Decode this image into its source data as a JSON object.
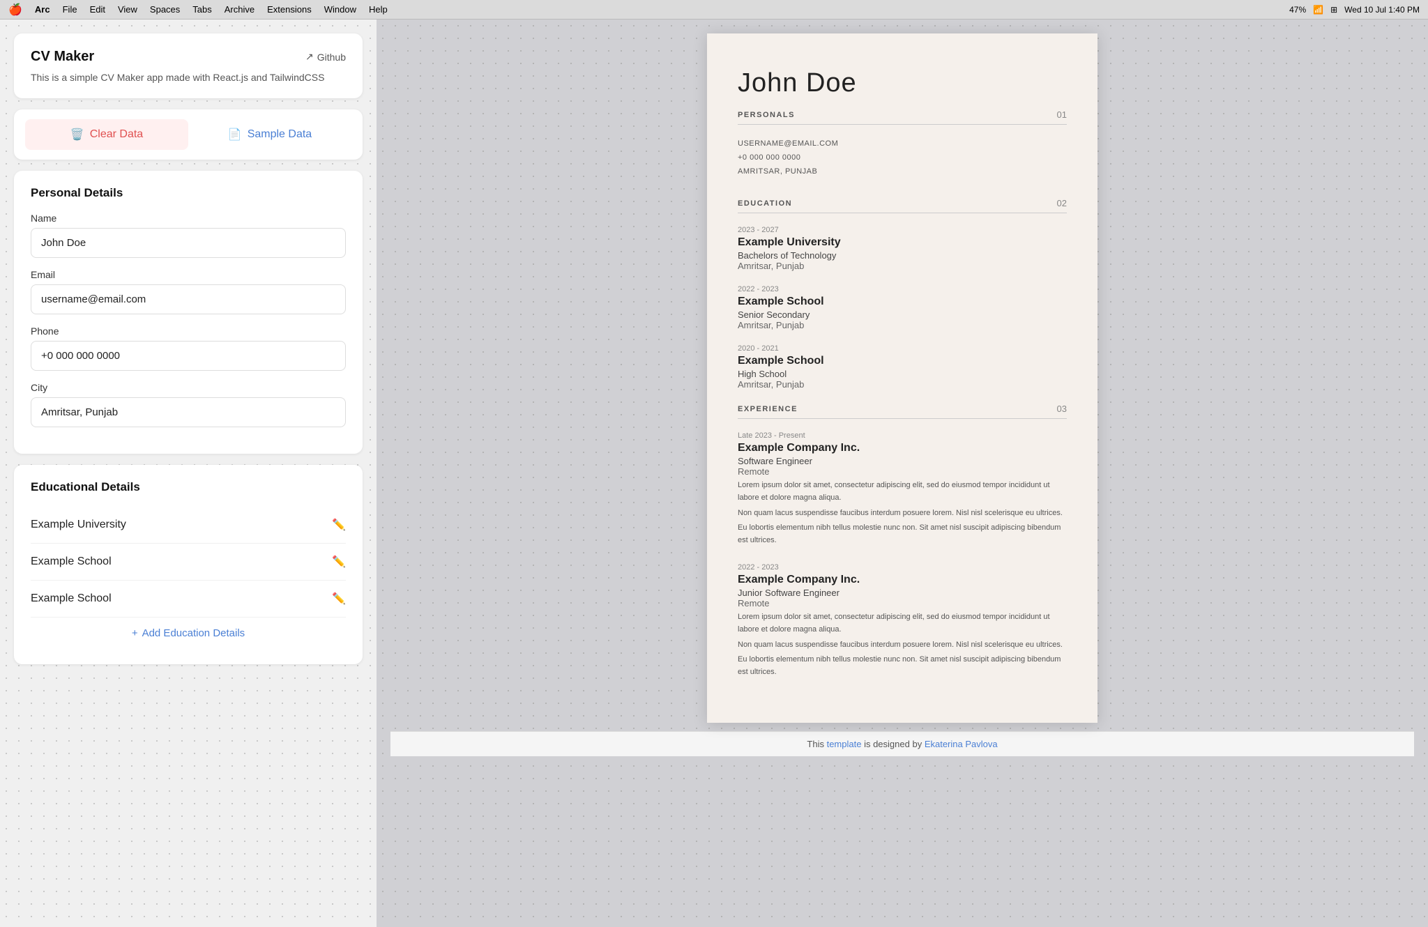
{
  "menubar": {
    "apple": "🍎",
    "app_name": "Arc",
    "menus": [
      "File",
      "Edit",
      "View",
      "Spaces",
      "Tabs",
      "Archive",
      "Extensions",
      "Window",
      "Help"
    ],
    "battery": "47%",
    "time": "Wed 10 Jul  1:40 PM"
  },
  "app": {
    "title": "CV Maker",
    "github_label": "Github",
    "description": "This is a simple CV Maker app made with React.js and TailwindCSS"
  },
  "buttons": {
    "clear_label": "Clear Data",
    "sample_label": "Sample Data"
  },
  "personal_details": {
    "section_title": "Personal Details",
    "name_label": "Name",
    "name_value": "John Doe",
    "email_label": "Email",
    "email_value": "username@email.com",
    "phone_label": "Phone",
    "phone_value": "+0 000 000 0000",
    "city_label": "City",
    "city_value": "Amritsar, Punjab"
  },
  "educational_details": {
    "section_title": "Educational Details",
    "items": [
      {
        "name": "Example University"
      },
      {
        "name": "Example School"
      },
      {
        "name": "Example School"
      }
    ],
    "add_label": "Add Education Details"
  },
  "cv": {
    "name": "John Doe",
    "personals_label": "PERSONALS",
    "personals_num": "01",
    "contact": {
      "email": "USERNAME@EMAIL.COM",
      "phone": "+0 000 000 0000",
      "city": "AMRITSAR, PUNJAB"
    },
    "education_label": "EDUCATION",
    "education_num": "02",
    "education_items": [
      {
        "years": "2023 - 2027",
        "name": "Example University",
        "degree": "Bachelors of Technology",
        "location": "Amritsar, Punjab"
      },
      {
        "years": "2022 - 2023",
        "name": "Example School",
        "degree": "Senior Secondary",
        "location": "Amritsar, Punjab"
      },
      {
        "years": "2020 - 2021",
        "name": "Example School",
        "degree": "High School",
        "location": "Amritsar, Punjab"
      }
    ],
    "experience_label": "EXPERIENCE",
    "experience_num": "03",
    "experience_items": [
      {
        "years": "Late 2023 - Present",
        "company": "Example Company Inc.",
        "title": "Software Engineer",
        "location": "Remote",
        "desc1": "Lorem ipsum dolor sit amet, consectetur adipiscing elit, sed do eiusmod tempor incididunt ut labore et dolore magna aliqua.",
        "desc2": "Non quam lacus suspendisse faucibus interdum posuere lorem. Nisl nisl scelerisque eu ultrices.",
        "desc3": "Eu lobortis elementum nibh tellus molestie nunc non. Sit amet nisl suscipit adipiscing bibendum est ultrices."
      },
      {
        "years": "2022 - 2023",
        "company": "Example Company Inc.",
        "title": "Junior Software Engineer",
        "location": "Remote",
        "desc1": "Lorem ipsum dolor sit amet, consectetur adipiscing elit, sed do eiusmod tempor incididunt ut labore et dolore magna aliqua.",
        "desc2": "Non quam lacus suspendisse faucibus interdum posuere lorem. Nisl nisl scelerisque eu ultrices.",
        "desc3": "Eu lobortis elementum nibh tellus molestie nunc non. Sit amet nisl suscipit adipiscing bibendum est ultrices."
      }
    ]
  },
  "footer": {
    "text_before": "This ",
    "link_label": "template",
    "text_after": " is designed by ",
    "designer": "Ekaterina Pavlova"
  }
}
